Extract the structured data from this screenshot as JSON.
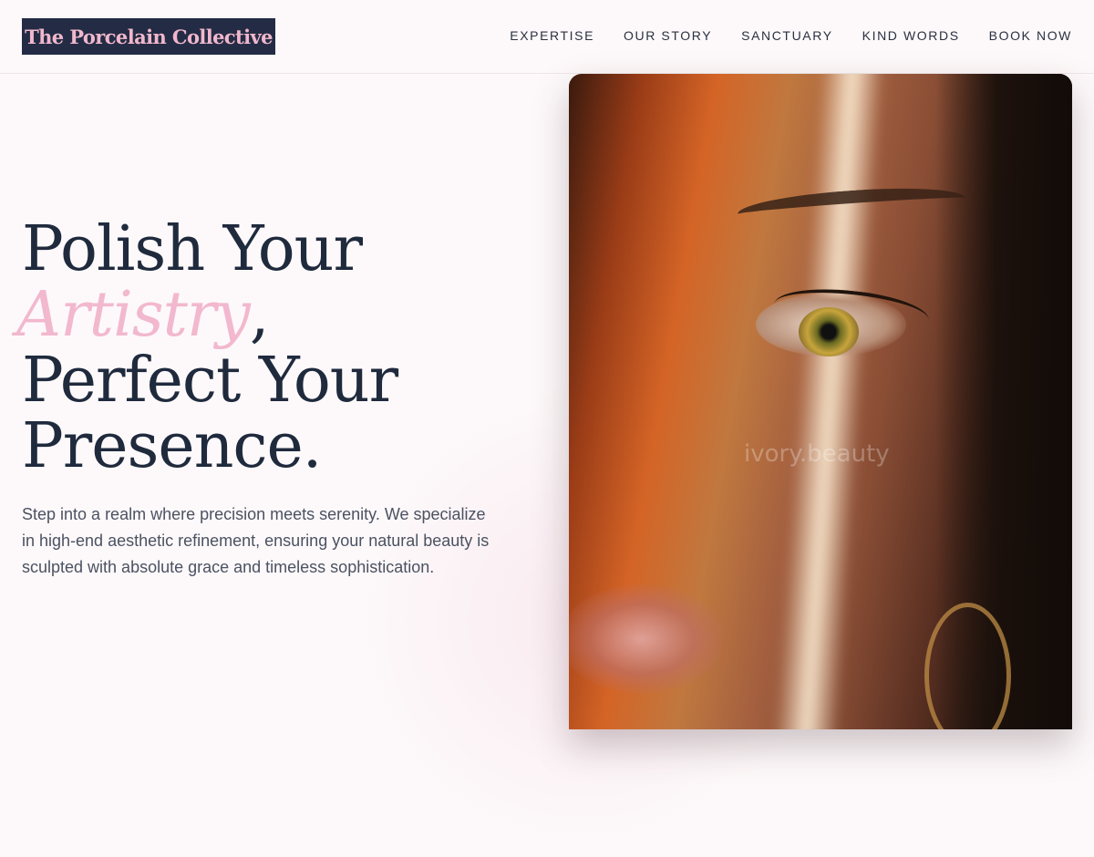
{
  "header": {
    "logo": "The Porcelain Collective",
    "nav": [
      "EXPERTISE",
      "OUR STORY",
      "SANCTUARY",
      "KIND WORDS",
      "BOOK NOW"
    ]
  },
  "hero": {
    "title_line1": "Polish Your",
    "title_accent": "Artistry",
    "title_comma": ",",
    "title_line3": "Perfect Your",
    "title_line4": "Presence.",
    "description": "Step into a realm where precision meets serenity. We specialize in high-end aesthetic refinement, ensuring your natural beauty is sculpted with absolute grace and timeless sophistication."
  },
  "image": {
    "watermark": "ivory.beauty"
  },
  "colors": {
    "navy": "#1f2a3d",
    "pink_accent": "#f2b8ce",
    "logo_bg": "#232c44",
    "background": "#fdf9fa"
  }
}
